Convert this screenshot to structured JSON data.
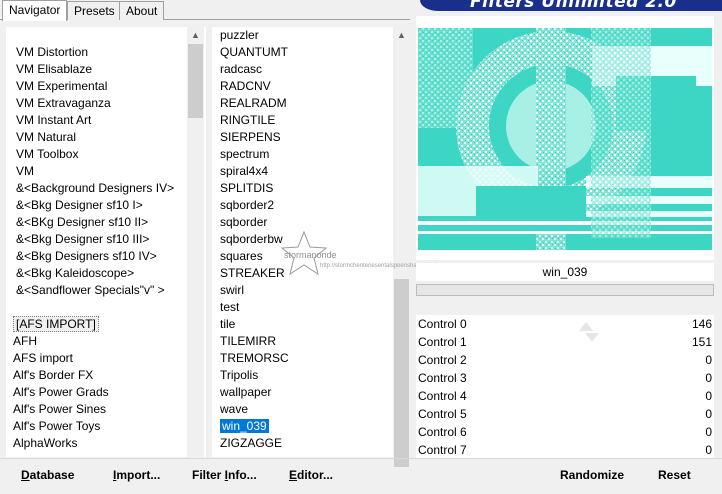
{
  "tabs": [
    "Navigator",
    "Presets",
    "About"
  ],
  "banner": "Filters Unlimited 2.0",
  "categories": [
    "VM Distortion",
    "VM Elisablaze",
    "VM Experimental",
    "VM Extravaganza",
    "VM Instant Art",
    "VM Natural",
    "VM Toolbox",
    "VM",
    "&<Background Designers IV>",
    "&<Bkg Designer sf10 I>",
    "&<BKg Designer sf10 II>",
    "&<Bkg Designer sf10 III>",
    "&<Bkg Designers sf10 IV>",
    "&<Bkg Kaleidoscope>",
    "&<Sandflower Specials\"v\" >",
    "",
    "[AFS IMPORT]",
    "AFH",
    "AFS import",
    "Alf's Border FX",
    "Alf's Power Grads",
    "Alf's Power Sines",
    "Alf's Power Toys",
    "AlphaWorks"
  ],
  "filters": [
    "puzzler",
    "QUANTUMT",
    "radcasc",
    "RADCNV",
    "REALRADM",
    "RINGTILE",
    "SIERPENS",
    "spectrum",
    "spiral4x4",
    "SPLITDIS",
    "sqborder2",
    "sqborder",
    "sqborderbw",
    "squares",
    "STREAKER",
    "swirl",
    "test",
    "tile",
    "TILEMIRR",
    "TREMORSC",
    "Tripolis",
    "wallpaper",
    "wave",
    "win_039",
    "ZIGZAGGE"
  ],
  "selected_filter": "win_039",
  "preview_filter_name": "win_039",
  "watermark": {
    "brand": "stormanonde",
    "url": "http://stormchenteriesentalspoensharen.de/"
  },
  "controls": [
    {
      "label": "Control 0",
      "value": "146",
      "level": 0.57
    },
    {
      "label": "Control 1",
      "value": "151",
      "level": 0.59
    },
    {
      "label": "Control 2",
      "value": "0",
      "level": 0
    },
    {
      "label": "Control 3",
      "value": "0",
      "level": 0
    },
    {
      "label": "Control 4",
      "value": "0",
      "level": 0
    },
    {
      "label": "Control 5",
      "value": "0",
      "level": 0
    },
    {
      "label": "Control 6",
      "value": "0",
      "level": 0
    },
    {
      "label": "Control 7",
      "value": "0",
      "level": 0
    }
  ],
  "buttons": {
    "database": {
      "u": "D",
      "rest": "atabase"
    },
    "import": {
      "u": "I",
      "rest": "mport..."
    },
    "filter_info": {
      "pre": "Filter ",
      "u": "I",
      "rest": "nfo..."
    },
    "editor": {
      "u": "E",
      "rest": "ditor..."
    },
    "randomize": "Randomize",
    "reset": "Reset"
  },
  "colors": {
    "accent": "#0078d7",
    "banner": "#1a2e8c",
    "preview_teal": "#3dd6c4"
  }
}
